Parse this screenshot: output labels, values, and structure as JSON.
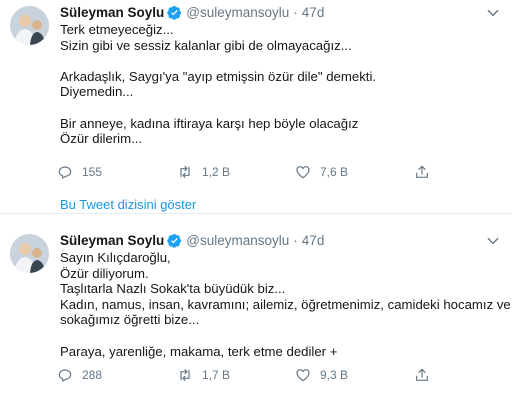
{
  "tweets": [
    {
      "display_name": "Süleyman Soylu",
      "handle": "@suleymansoylu",
      "separator": "·",
      "time": "47d",
      "lines": [
        "Terk etmeyeceğiz...",
        "Sizin gibi ve sessiz kalanlar gibi de olmayacağız...",
        "",
        "Arkadaşlık, Saygı'ya \"ayıp etmişsin özür dile\" demekti.",
        "Diyemedin...",
        "",
        "Bir anneye, kadına iftiraya karşı hep böyle olacağız",
        "Özür dilerim..."
      ],
      "replies": "155",
      "retweets": "1,2 B",
      "likes": "7,6 B"
    },
    {
      "display_name": "Süleyman Soylu",
      "handle": "@suleymansoylu",
      "separator": "·",
      "time": "47d",
      "lines": [
        "Sayın Kılıçdaroğlu,",
        "Özür diliyorum.",
        "Taşlıtarla Nazlı Sokak'ta büyüdük biz...",
        "Kadın, namus, insan, kavramını; ailemiz, öğretmenimiz, camideki hocamız ve",
        "sokağımız öğretti bize...",
        "",
        "Paraya, yarenliğe, makama, terk etme dediler +"
      ],
      "replies": "288",
      "retweets": "1,7 B",
      "likes": "9,3 B"
    }
  ],
  "thread_link": "Bu Tweet dizisini göster",
  "icons": {
    "verified": "verified-badge-icon",
    "more": "chevron-down-icon",
    "reply": "reply-icon",
    "retweet": "retweet-icon",
    "like": "heart-icon",
    "share": "share-icon"
  },
  "colors": {
    "text": "#14171a",
    "secondary": "#657786",
    "link": "#1b95e0",
    "verified": "#1da1f2",
    "divider": "#e6ecf0"
  }
}
